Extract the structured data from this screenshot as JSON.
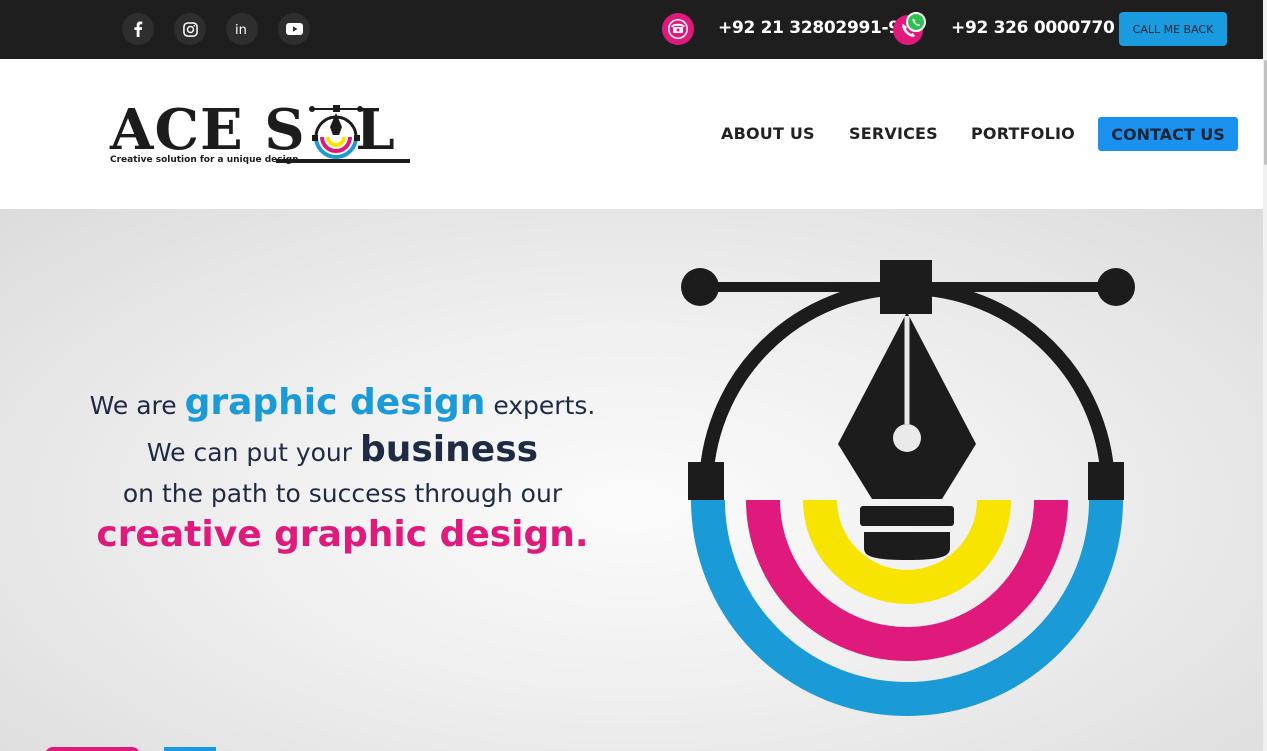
{
  "topbar": {
    "social": [
      {
        "name": "facebook-icon",
        "glyph": "f"
      },
      {
        "name": "instagram-icon",
        "glyph": "instagram"
      },
      {
        "name": "linkedin-icon",
        "glyph": "in"
      },
      {
        "name": "youtube-icon",
        "glyph": "youtube"
      }
    ],
    "phone1": "+92 21 32802991-92",
    "phone2": "+92 326 0000770",
    "callback_label": "CALL ME BACK"
  },
  "header": {
    "logo_text": "ACE SOL",
    "logo_tagline": "Creative solution for a unique design",
    "nav": [
      "ABOUT US",
      "SERVICES",
      "PORTFOLIO",
      "CONTACT US"
    ]
  },
  "hero": {
    "line1_a": "We are ",
    "line1_b": "graphic design",
    "line1_c": " experts.",
    "line2_a": "We can put your ",
    "line2_b": "business",
    "line3": "on the path to success through our",
    "line4": "creative graphic design."
  },
  "colors": {
    "cyan": "#1a9ad6",
    "magenta": "#e0197d",
    "yellow": "#f7e400",
    "dark": "#1c1c1c"
  }
}
